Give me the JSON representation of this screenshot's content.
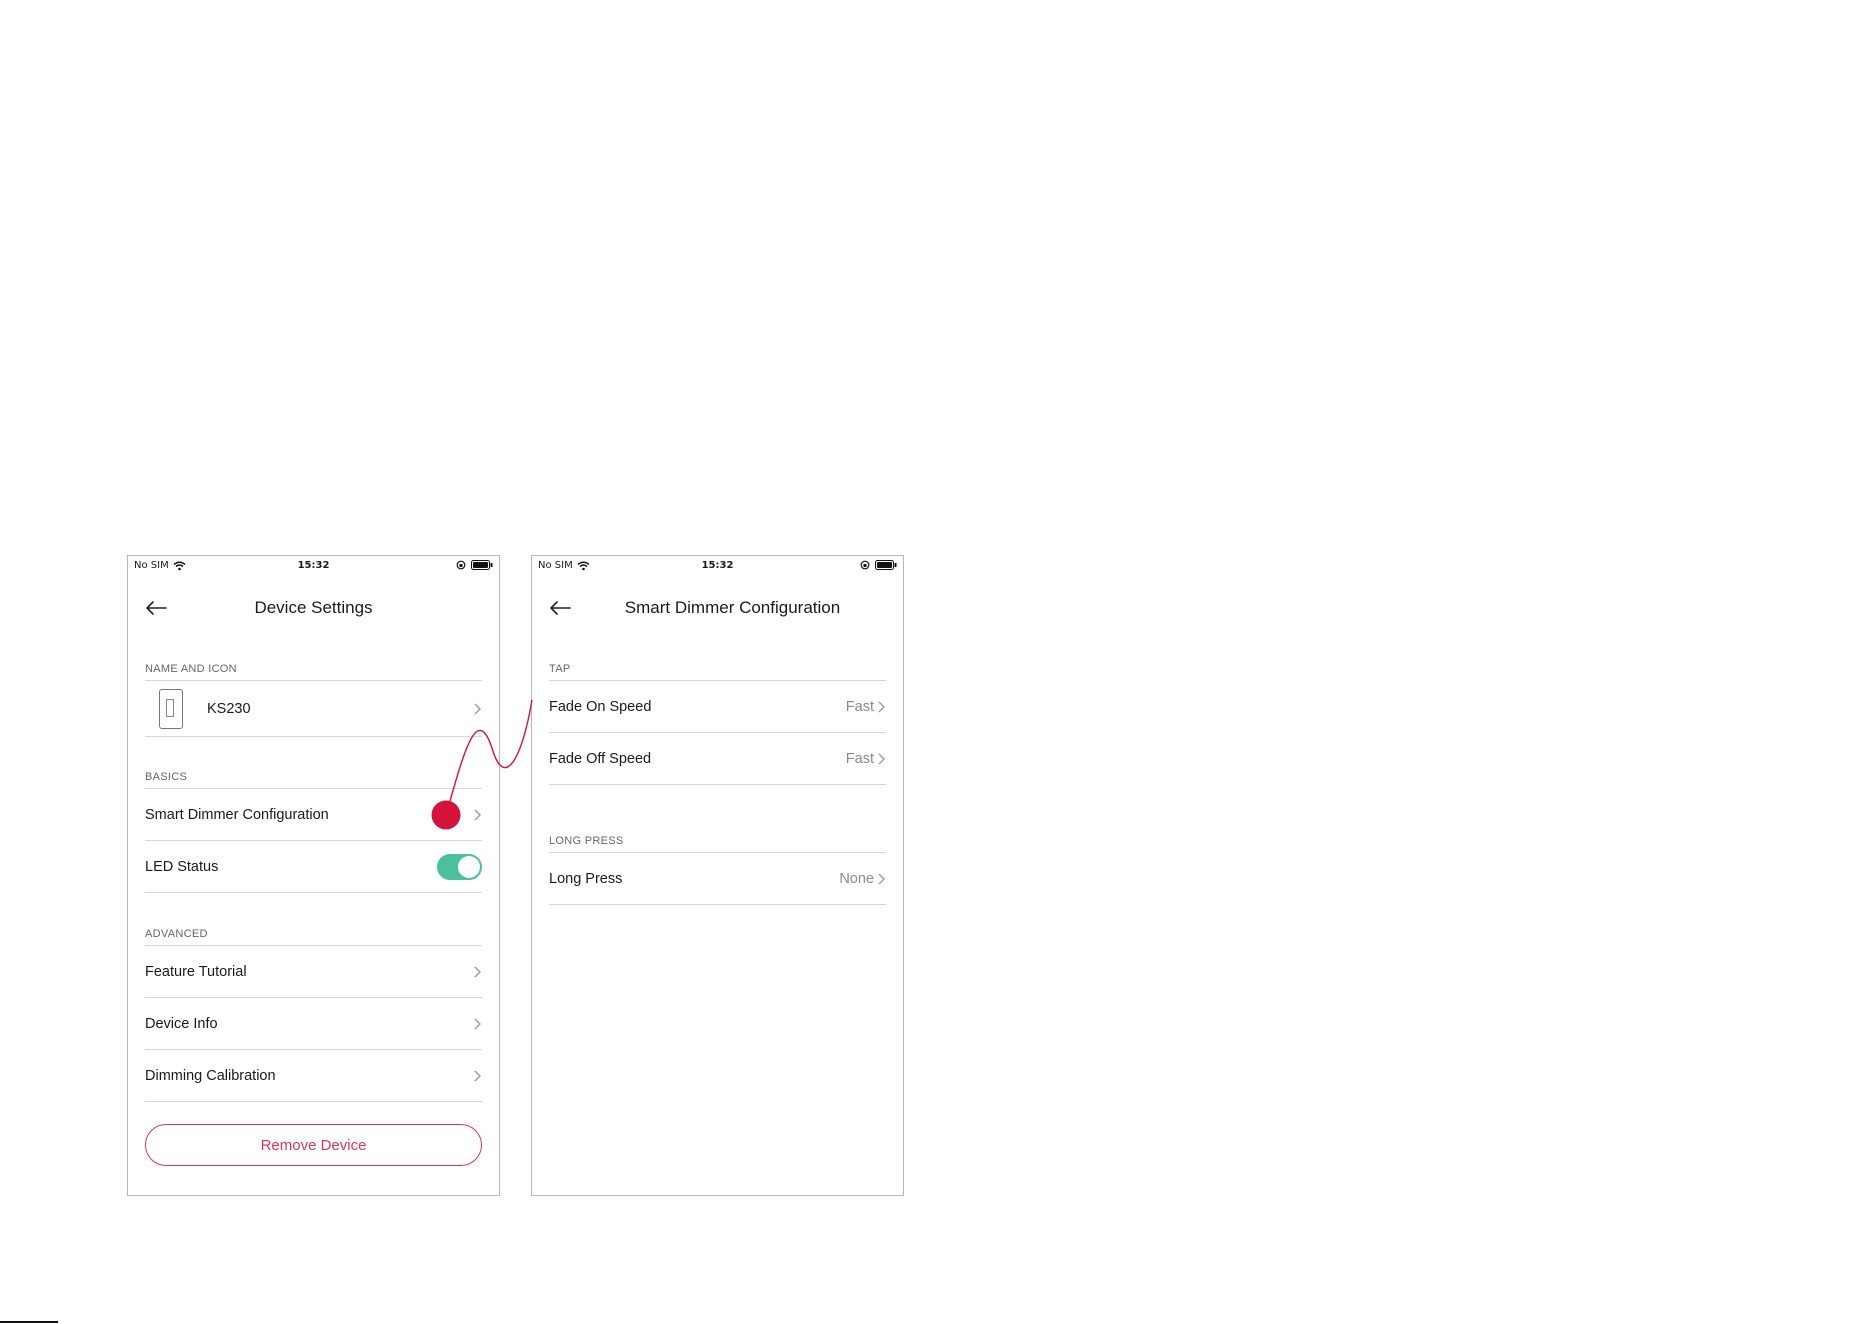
{
  "status_bar": {
    "carrier": "No SIM",
    "time": "15:32",
    "icons": [
      "wifi-icon",
      "lock-rotation-icon",
      "battery-icon"
    ]
  },
  "screen_left": {
    "title": "Device Settings",
    "section_name_and_icon": "NAME AND ICON",
    "device_name": "KS230",
    "section_basics": "BASICS",
    "basics_items": [
      {
        "label": "Smart Dimmer Configuration"
      },
      {
        "label": "LED Status",
        "toggle_on": true
      }
    ],
    "section_advanced": "ADVANCED",
    "advanced_items": [
      {
        "label": "Feature Tutorial"
      },
      {
        "label": "Device Info"
      },
      {
        "label": "Dimming Calibration"
      }
    ],
    "remove_button": "Remove Device"
  },
  "screen_right": {
    "title": "Smart Dimmer Configuration",
    "section_tap": "TAP",
    "tap_items": [
      {
        "label": "Fade On Speed",
        "value": "Fast"
      },
      {
        "label": "Fade Off Speed",
        "value": "Fast"
      }
    ],
    "section_long_press": "LONG PRESS",
    "long_press_items": [
      {
        "label": "Long Press",
        "value": "None"
      }
    ]
  },
  "colors": {
    "accent_red": "#e0354f",
    "callout_red": "#d4123a",
    "toggle_green": "#4cbf9e",
    "divider": "#d6d6d6"
  }
}
